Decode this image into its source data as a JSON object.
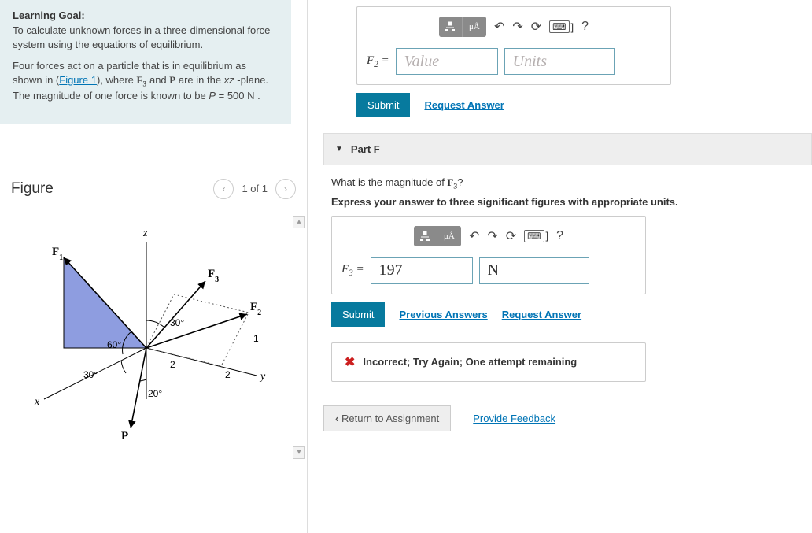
{
  "learning": {
    "heading": "Learning Goal:",
    "goal": "To calculate unknown forces in a three-dimensional force system using the equations of equilibrium.",
    "setup_pre": "Four forces act on a particle that is in equilibrium as shown in (",
    "figure_link": "Figure 1",
    "setup_post": "), where F₃ and P are in the xz -plane. The magnitude of one force is known to be P = 500 N ."
  },
  "figure": {
    "title": "Figure",
    "counter": "1 of 1"
  },
  "partE": {
    "label_html": "F₂ =",
    "value_placeholder": "Value",
    "units_placeholder": "Units",
    "submit": "Submit",
    "request": "Request Answer"
  },
  "partF": {
    "header": "Part F",
    "question": "What is the magnitude of F₃?",
    "instruction": "Express your answer to three significant figures with appropriate units.",
    "label_html": "F₃ =",
    "value": "197",
    "units": "N",
    "submit": "Submit",
    "previous": "Previous Answers",
    "request": "Request Answer",
    "feedback": "Incorrect; Try Again; One attempt remaining"
  },
  "footer": {
    "return": "Return to Assignment",
    "feedback": "Provide Feedback"
  },
  "icons": {
    "mu_a": "μÅ",
    "help": "?",
    "undo": "↶",
    "redo": "↷",
    "refresh": "⟳",
    "keyboard": "⌨",
    "bracket": "]",
    "cross": "✖",
    "chevron_left": "‹",
    "chevron_right": "›",
    "triangle_down": "▼",
    "arrow_up": "▴",
    "arrow_down": "▾"
  }
}
